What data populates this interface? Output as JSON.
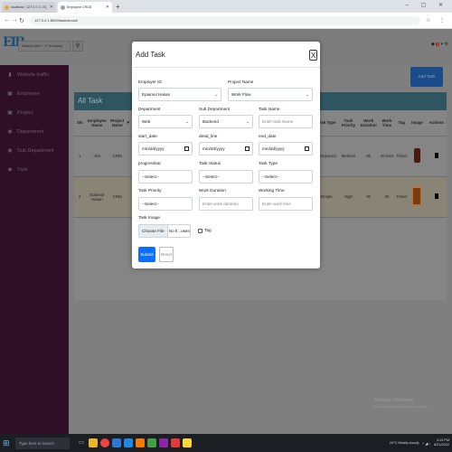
{
  "browser": {
    "tabs": [
      {
        "label": "localhost / 127.0.0.1 / 20_pegaus",
        "active": false
      },
      {
        "label": "Employee CRUD",
        "active": true
      }
    ],
    "new_tab": "+",
    "url": "127.0.0.1:8000/task/show#",
    "window_controls": "–  ▢  ✕"
  },
  "app": {
    "logo": "EIB",
    "search_placeholder": "Search (ctrl + \"/\" to focus)",
    "top_right_count": "1",
    "add_task_label": "Add Task",
    "sidebar": [
      {
        "icon": "traffic-icon",
        "glyph": "▮",
        "label": "Website traffic"
      },
      {
        "icon": "chart-icon",
        "glyph": "▣",
        "label": "Employee"
      },
      {
        "icon": "chart-icon",
        "glyph": "▣",
        "label": "Project"
      },
      {
        "icon": "globe-icon",
        "glyph": "◉",
        "label": "Department"
      },
      {
        "icon": "globe-icon",
        "glyph": "◉",
        "label": "Sub Department"
      },
      {
        "icon": "globe-icon",
        "glyph": "◉",
        "label": "Task"
      }
    ],
    "table": {
      "title": "All Task",
      "headers_left": [
        "SN",
        "Employee Name",
        "Project Name",
        "P"
      ],
      "headers_right": [
        "Task Type",
        "Task Priority",
        "Work Duration",
        "Work Time",
        "Tag",
        "Image",
        "Actions"
      ],
      "rows": [
        {
          "sn": "1",
          "employee": "Abir",
          "project": "CRM",
          "task_type": "Compound",
          "priority": "Medium",
          "duration": "8h",
          "time": "30 mint",
          "tag": "Ticket"
        },
        {
          "sn": "2",
          "employee": "Epiamul Hasan",
          "project": "CRM",
          "task_type": "Simple",
          "priority": "High",
          "duration": "8h",
          "time": "2h",
          "tag": "Ticket"
        }
      ]
    }
  },
  "modal": {
    "title": "Add Task",
    "close": "X",
    "employer_id_label": "Employer ID",
    "employer_id_value": "Epiamul Hasan",
    "project_name_label": "Project Name",
    "project_name_value": "Work Flow",
    "department_label": "Department",
    "department_value": "Web",
    "sub_department_label": "Sub Department",
    "sub_department_value": "Backend",
    "task_name_label": "Task Name",
    "task_name_placeholder": "Enter task Name",
    "start_date_label": "start_date",
    "date_placeholder": "mm/dd/yyyy",
    "deadline_label": "dead_line",
    "end_date_label": "end_date",
    "progressbar_label": "progressbar",
    "select_placeholder": "--Select--",
    "task_status_label": "Task Status",
    "task_type_label": "Task Type",
    "task_priority_label": "Task Priority",
    "work_duration_label": "Work Duration",
    "work_duration_placeholder": "Enter work duration",
    "working_time_label": "Working Time",
    "working_time_placeholder": "Enter work time",
    "task_image_label": "Task Image",
    "choose_file": "Choose File",
    "no_file": "No fi...osen",
    "tag_label": "Tag",
    "submit_label": "Submit",
    "reset_label": "Reset"
  },
  "watermark": {
    "title": "Activate Windows",
    "subtitle": "Go to Settings to activate Windows."
  },
  "taskbar": {
    "search_placeholder": "Type here to search",
    "weather": "24°C Mostly cloudy",
    "time": "3:13 PM",
    "date": "8/21/2022"
  }
}
